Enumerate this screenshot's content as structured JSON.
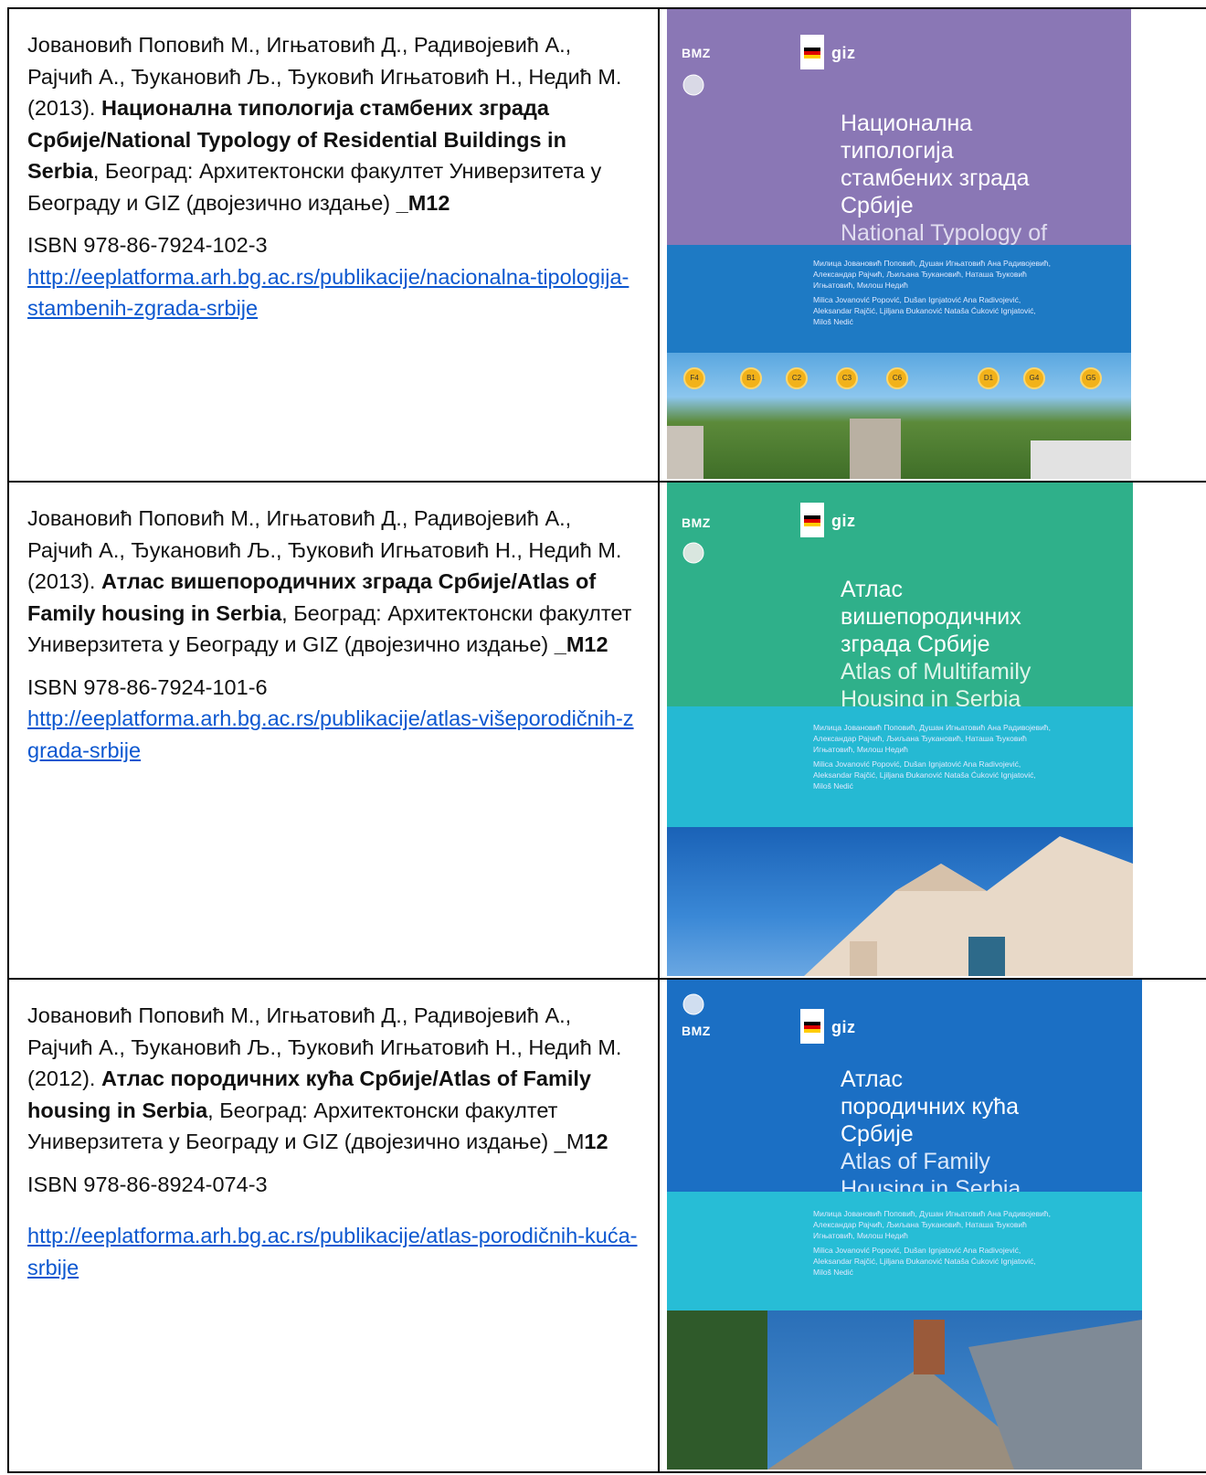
{
  "rows": [
    {
      "authors": "Јовановић Поповић М., Игњатовић Д., Радивојевић А., Рајчић А., Ђукановић Љ., Ђуковић Игњатовић Н., Недић М. (2013).",
      "title": "Национална типологија стамбених зграда Србије/National Typology of Residential Buildings in Serbia",
      "publisher": ", Београд: Архитектонски факултет Универзитета у Београду и GIZ (двојезично издање) ",
      "category": "_M12",
      "isbn": "ISBN 978-86-7924-102-3",
      "url": "http://eeplatforma.arh.bg.ac.rs/publikacije/nacionalna-tipologija-stambenih-zgrada-srbije",
      "cover": {
        "title_sr": "Национална типологија стамбених зграда Србије",
        "title_en": "National Typology of Residential Buildings in Serbia",
        "names_sr": "Милица Јовановић Поповић, Душан Игњатовић Ана Радивојевић, Александар Рајчић, Љиљана Ђукановић, Наташа Ђуковић Игњатовић, Милош Недић",
        "names_lat": "Milica Jovanović Popović, Dušan Ignjatović Ana Radivojević, Aleksandar Rajčić, Ljiljana Đukanović Nataša Ćuković Ignjatović, Miloš Nedić",
        "markers": [
          "F4",
          "B1",
          "C2",
          "C3",
          "C6",
          "D1",
          "G4",
          "G5"
        ],
        "top_color": "#8a77b5",
        "mid_color": "#1e7ac4"
      }
    },
    {
      "authors": "Јовановић Поповић М., Игњатовић Д., Радивојевић А., Рајчић А., Ђукановић Љ., Ђуковић Игњатовић Н., Недић М. (2013).",
      "title": "Атлас вишепородичних зграда Србије/Atlas of Family housing in Serbia",
      "publisher": ", Београд: Архитектонски факултет Универзитета у Београду и GIZ  (двојезично издање) ",
      "category": "_M12",
      "isbn": "ISBN 978-86-7924-101-6",
      "url": "http://eeplatforma.arh.bg.ac.rs/publikacije/atlas-višeporodičnih-zgrada-srbije",
      "cover": {
        "title_sr": "Атлас вишепородичних зграда Србије",
        "title_en": "Atlas of Multifamily Housing in Serbia",
        "names_sr": "Милица Јовановић Поповић, Душан Игњатовић Ана Радивојевић, Александар Рајчић, Љиљана Ђукановић, Наташа Ђуковић Игњатовић, Милош Недић",
        "names_lat": "Milica Jovanović Popović, Dušan Ignjatović Ana Radivojević, Aleksandar Rajčić, Ljiljana Đukanović Nataša Ćuković Ignjatović, Miloš Nedić",
        "top_color": "#2fb08a",
        "mid_color": "#25b9d3"
      }
    },
    {
      "authors": "Јовановић Поповић М., Игњатовић Д., Радивојевић А., Рајчић А., Ђукановић Љ., Ђуковић Игњатовић Н., Недић М. (2012).",
      "title": "Атлас породичних кућа Србије/Atlas of Family housing in Serbia",
      "publisher": ", Београд: Архитектонски факултет Универзитета у Београду и GIZ  (двојезично издање) ",
      "category_prefix": "_M",
      "category_bold": "12",
      "isbn": "ISBN 978-86-8924-074-3",
      "url": "http://eeplatforma.arh.bg.ac.rs/publikacije/atlas-porodičnih-kuća-srbije",
      "cover": {
        "title_sr": "Атлас породичних кућа Србије",
        "title_en": "Atlas of Family Housing in Serbia",
        "names_sr": "Милица Јовановић Поповић, Душан Игњатовић Ана Радивојевић, Александар Рајчић, Љиљана Ђукановић, Наташа Ђуковић Игњатовић, Милош Недић",
        "names_lat": "Milica Jovanović Popović, Dušan Ignjatović Ana Radivojević, Aleksandar Rajčić, Ljiljana Đukanović Nataša Ćuković Ignjatović, Miloš Nedić",
        "top_color": "#1b6fc4",
        "mid_color": "#27bdd6"
      }
    }
  ],
  "logos": {
    "bmz": "BMZ",
    "giz": "giz"
  }
}
